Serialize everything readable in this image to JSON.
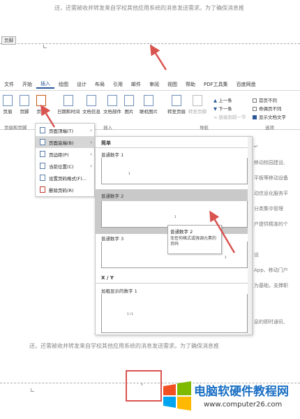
{
  "document": {
    "top_text": "送，还需被收并转发来自学校其他应用系统的消息发送需求。为了确保消息推",
    "header_tab": "页脚",
    "bottom_text": "送，还需被收并转发来自学校其他应用系统的消息发送需求。为了确保消息推"
  },
  "ribbon": {
    "tabs": [
      "文件",
      "开始",
      "插入",
      "绘图",
      "设计",
      "布局",
      "引用",
      "邮件",
      "审阅",
      "视图",
      "帮助",
      "PDF工具集",
      "百度网盘"
    ],
    "active_tab": "插入",
    "buttons": {
      "header": "页眉",
      "footer": "页脚",
      "page_number": "页码",
      "datetime": "日期和时间",
      "doc_info": "文档信息",
      "doc_parts": "文档部件",
      "picture": "图片",
      "online_picture": "联机图片",
      "goto_header": "转至页眉",
      "goto_footer": "转至页脚",
      "prev": "上一条",
      "next": "下一条",
      "link_prev": "链接到前一节"
    },
    "options": {
      "first_page": "首页不同",
      "odd_even": "奇偶页不同",
      "show_text": "显示文档文字"
    },
    "groups": {
      "header_footer": "页眉和页脚",
      "insert": "插入",
      "navigation": "导航",
      "options": "选项"
    }
  },
  "page_number_menu": {
    "items": [
      {
        "label": "页面顶端(T)",
        "has_sub": true
      },
      {
        "label": "页面底端(B)",
        "has_sub": true
      },
      {
        "label": "页边距(P)",
        "has_sub": true
      },
      {
        "label": "当前位置(C)",
        "has_sub": true
      },
      {
        "label": "设置页码格式(F)...",
        "has_sub": false
      },
      {
        "label": "删除页码(R)",
        "has_sub": false
      }
    ]
  },
  "gallery": {
    "section_simple": "简单",
    "items": [
      "普通数字 1",
      "普通数字 2",
      "普通数字 3"
    ],
    "section_xy": "X / Y",
    "item_bold": "加粗显示的数字 1"
  },
  "tooltip": {
    "title": "普通数字 2",
    "desc": "无任何格式或强调元素的页码"
  },
  "background_doc": [
    "移动校园建设,",
    "平板等移动设备",
    "动信息化服务平",
    "分类集中管理",
    "户提供精准的个",
    "设",
    "App、移动门户",
    "为基础，支撑职",
    "息的即时通讯,"
  ],
  "logo": {
    "title": "电脑软硬件教程网",
    "url": "www.computer26.com"
  },
  "colors": {
    "accent": "#2b579a",
    "arrow": "#d9534f",
    "logo_blue": "#1a6fc4"
  }
}
